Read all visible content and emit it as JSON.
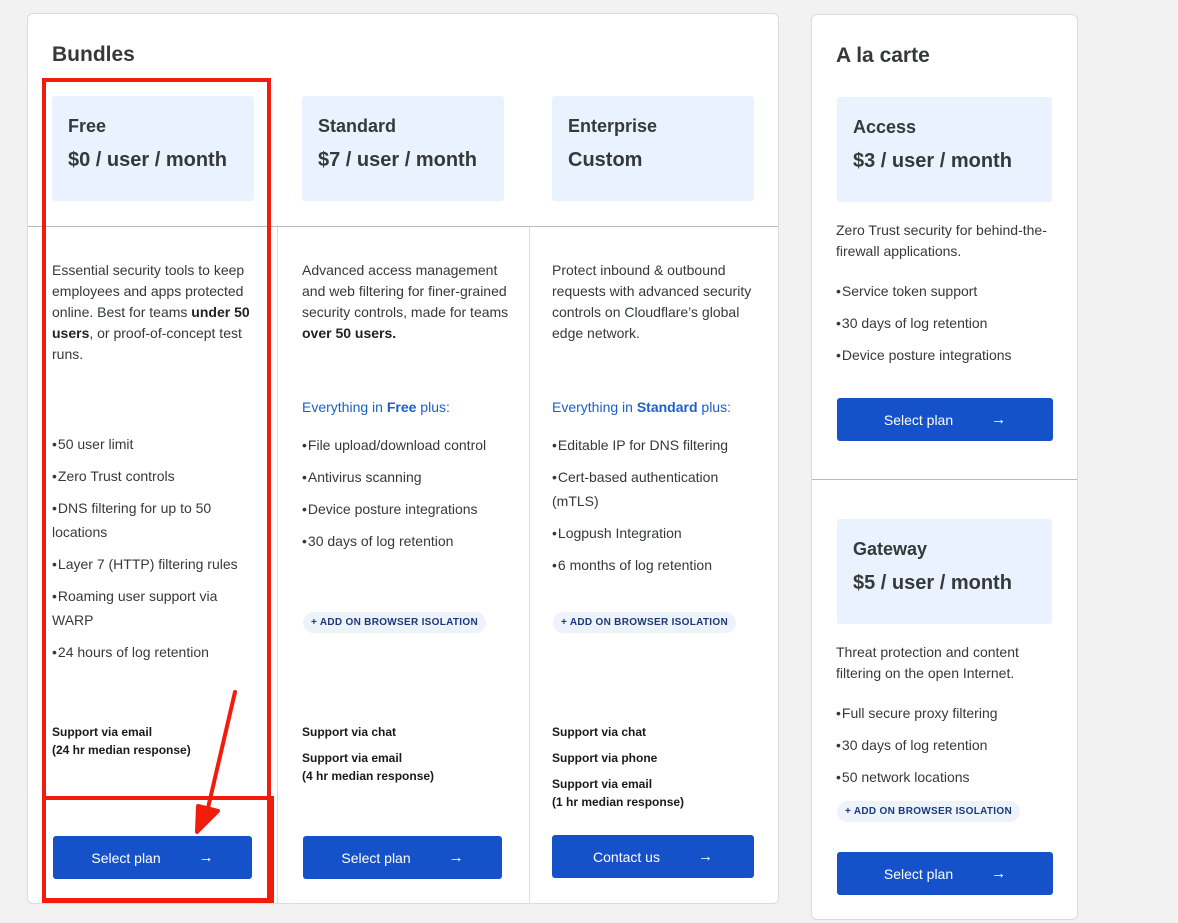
{
  "bundles": {
    "title": "Bundles",
    "free": {
      "name": "Free",
      "price": "$0 / user / month",
      "desc_pre": "Essential security tools to keep employees and apps protected online. Best for teams ",
      "desc_bold1": "under 50 users",
      "desc_post": ", or proof-of-concept test runs.",
      "features": [
        "50 user limit",
        "Zero Trust controls",
        "DNS filtering for up to 50 locations",
        "Layer 7 (HTTP) filtering rules",
        "Roaming user support via WARP",
        "24 hours of log retention"
      ],
      "support": [
        "Support via email",
        "(24 hr median response)"
      ],
      "button": "Select plan"
    },
    "standard": {
      "name": "Standard",
      "price": "$7 / user / month",
      "desc_pre": "Advanced access management and web filtering for finer-grained security controls, made for teams ",
      "desc_bold": "over 50 users.",
      "plus_pre": "Everything in ",
      "plus_bold": "Free",
      "plus_post": " plus:",
      "features": [
        "File upload/download control",
        "Antivirus scanning",
        "Device posture integrations",
        "30 days of log retention"
      ],
      "addon": "+ ADD ON BROWSER ISOLATION",
      "support1": "Support via chat",
      "support2": [
        "Support via email",
        "(4 hr median response)"
      ],
      "button": "Select plan"
    },
    "enterprise": {
      "name": "Enterprise",
      "price": "Custom",
      "desc": "Protect inbound & outbound requests with advanced security controls on Cloudflare’s global edge network.",
      "plus_pre": "Everything in ",
      "plus_bold": "Standard",
      "plus_post": " plus:",
      "features": [
        "Editable IP for DNS filtering",
        "Cert-based authentication (mTLS)",
        "Logpush Integration",
        "6 months of log retention"
      ],
      "addon": "+ ADD ON BROWSER ISOLATION",
      "support1": "Support via chat",
      "support2": "Support via phone",
      "support3": [
        "Support via email",
        "(1 hr median response)"
      ],
      "button": "Contact us"
    }
  },
  "alacarte": {
    "title": "A la carte",
    "access": {
      "name": "Access",
      "price": "$3 / user / month",
      "desc": "Zero Trust security for behind-the-firewall applications.",
      "features": [
        "Service token support",
        "30 days of log retention",
        "Device posture integrations"
      ],
      "button": "Select plan"
    },
    "gateway": {
      "name": "Gateway",
      "price": "$5 / user / month",
      "desc": "Threat protection and content filtering on the open Internet.",
      "features": [
        "Full secure proxy filtering",
        "30 days of log retention",
        "50 network locations"
      ],
      "addon": "+ ADD ON BROWSER ISOLATION",
      "button": "Select plan"
    }
  },
  "icons": {
    "button_arrow": "arrow-right-icon",
    "arrow_glyph": "→"
  },
  "colors": {
    "primary_button": "#1552c9",
    "plan_header_bg": "#e9f2fe",
    "highlight": "#f21c0c",
    "link_blue": "#1d5fc9"
  }
}
